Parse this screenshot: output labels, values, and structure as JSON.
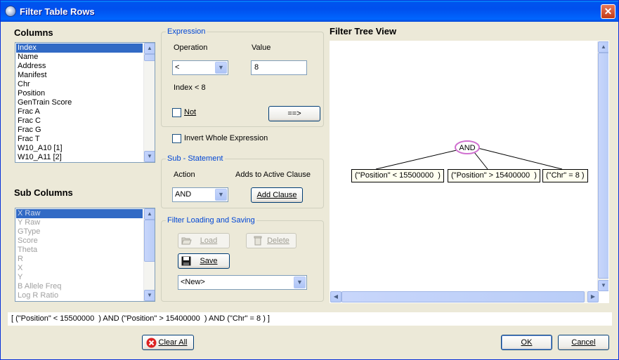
{
  "window": {
    "title": "Filter Table Rows",
    "close_glyph": "✕"
  },
  "columns": {
    "heading": "Columns",
    "items": [
      "Index",
      "Name",
      "Address",
      "Manifest",
      "Chr",
      "Position",
      "GenTrain Score",
      "Frac A",
      "Frac C",
      "Frac G",
      "Frac T",
      "W10_A10 [1]",
      "W10_A11 [2]"
    ],
    "selected_index": 0
  },
  "sub_columns": {
    "heading": "Sub Columns",
    "items": [
      "X Raw",
      "Y Raw",
      "GType",
      "Score",
      "Theta",
      "R",
      "X",
      "Y",
      "B Allele Freq",
      "Log R Ratio"
    ],
    "selected_index": 0
  },
  "expression": {
    "legend": "Expression",
    "operation_label": "Operation",
    "operation_value": "<",
    "value_label": "Value",
    "value_value": "8",
    "preview": "Index < 8",
    "not_label": "Not",
    "add_button": "==>"
  },
  "invert": {
    "label": "Invert Whole Expression"
  },
  "sub_statement": {
    "legend": "Sub - Statement",
    "action_label": "Action",
    "action_value": "AND",
    "adds_label": "Adds to Active Clause",
    "add_clause_button": "Add Clause"
  },
  "filter_io": {
    "legend": "Filter Loading and Saving",
    "load_button": "Load",
    "delete_button": "Delete",
    "save_button": "Save",
    "filter_select_value": "<New>"
  },
  "tree_view": {
    "heading": "Filter Tree View",
    "root": "AND",
    "children": [
      "(\"Position\" < 15500000  )",
      "(\"Position\" > 15400000  )",
      "(\"Chr\" = 8 )"
    ]
  },
  "expression_text": "[ (\"Position\" < 15500000  ) AND (\"Position\" > 15400000  ) AND (\"Chr\" = 8 ) ]",
  "footer": {
    "clear_all": "Clear All",
    "ok": "OK",
    "cancel": "Cancel"
  },
  "colors": {
    "title_blue": "#0053ee",
    "selection": "#316ac5",
    "legend_text": "#0046d5",
    "tree_root_border": "#d070d0"
  }
}
